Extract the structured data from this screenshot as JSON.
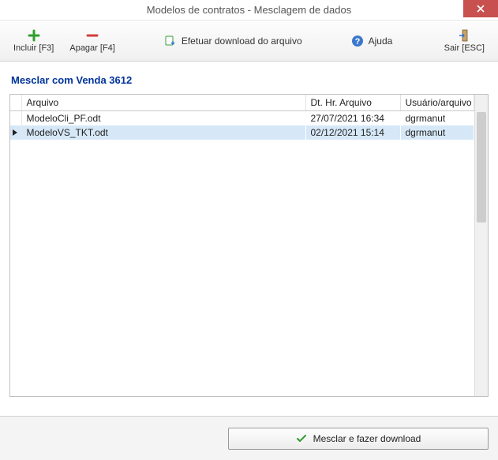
{
  "window": {
    "title": "Modelos de contratos - Mesclagem de dados"
  },
  "toolbar": {
    "include_label": "Incluir [F3]",
    "delete_label": "Apagar [F4]",
    "download_label": "Efetuar download do arquivo",
    "help_label": "Ajuda",
    "exit_label": "Sair [ESC]"
  },
  "section": {
    "title": "Mesclar com Venda 3612"
  },
  "grid": {
    "columns": {
      "file": "Arquivo",
      "date": "Dt. Hr. Arquivo",
      "user": "Usuário/arquivo"
    },
    "rows": [
      {
        "file": "ModeloCli_PF.odt",
        "date": "27/07/2021 16:34",
        "user": "dgrmanut",
        "selected": false
      },
      {
        "file": "ModeloVS_TKT.odt",
        "date": "02/12/2021 15:14",
        "user": "dgrmanut",
        "selected": true
      }
    ]
  },
  "footer": {
    "merge_label": "Mesclar e fazer download"
  }
}
